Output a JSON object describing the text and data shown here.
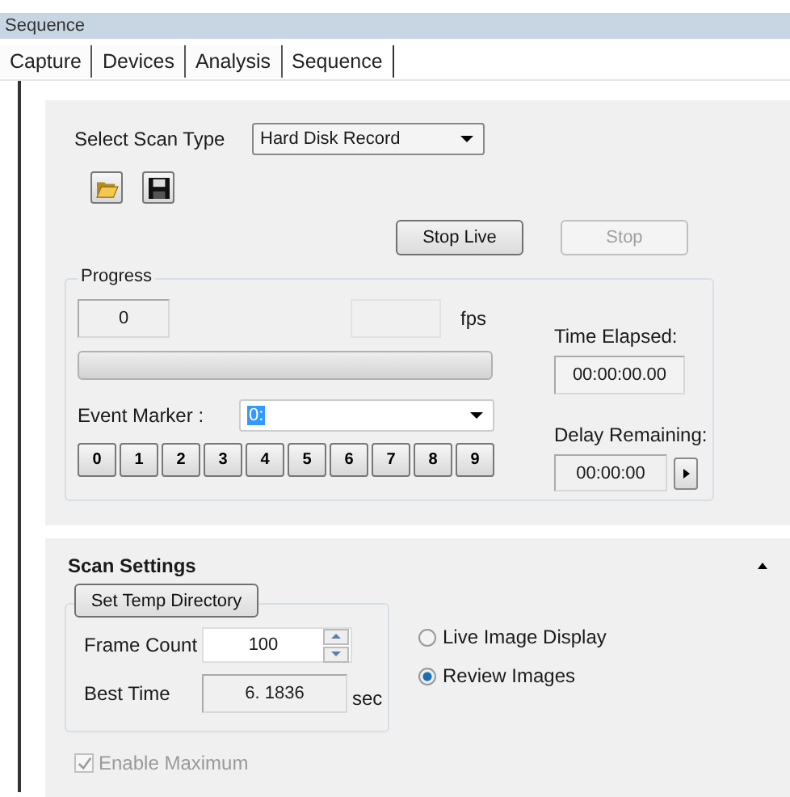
{
  "window": {
    "title": "Sequence"
  },
  "tabs": [
    {
      "label": "Capture",
      "selected": false
    },
    {
      "label": "Devices",
      "selected": false
    },
    {
      "label": "Analysis",
      "selected": false
    },
    {
      "label": "Sequence",
      "selected": true
    }
  ],
  "scan_type": {
    "label": "Select Scan Type",
    "value": "Hard Disk Record"
  },
  "buttons": [
    {
      "label": "Stop Live",
      "disabled": false
    },
    {
      "label": "Stop",
      "disabled": true
    }
  ],
  "progress": {
    "title": "Progress",
    "count": "0",
    "fps_unit": "fps",
    "level": 0,
    "time_elapsed_label": "Time Elapsed:",
    "time_elapsed": "00:00:00.00",
    "event_marker_label": "Event Marker :",
    "event_marker": "0:",
    "delay_remaining_label": "Delay Remaining:",
    "delay_remaining": "00:00:00",
    "marker_keys": [
      "0",
      "1",
      "2",
      "3",
      "4",
      "5",
      "6",
      "7",
      "8",
      "9"
    ]
  },
  "scan_settings": {
    "title": "Scan Settings",
    "expanded": true,
    "temp_dir_button": "Set Temp Directory",
    "frame_count_label": "Frame Count",
    "frame_count": "100",
    "best_time_label": "Best Time",
    "best_time": "6. 1836",
    "best_time_unit": "sec",
    "display_options": [
      {
        "label": "Live Image Display",
        "selected": false
      },
      {
        "label": "Review Images",
        "selected": true
      }
    ],
    "enable_maximum": {
      "label": "Enable Maximum",
      "checked": true,
      "disabled": true
    }
  }
}
